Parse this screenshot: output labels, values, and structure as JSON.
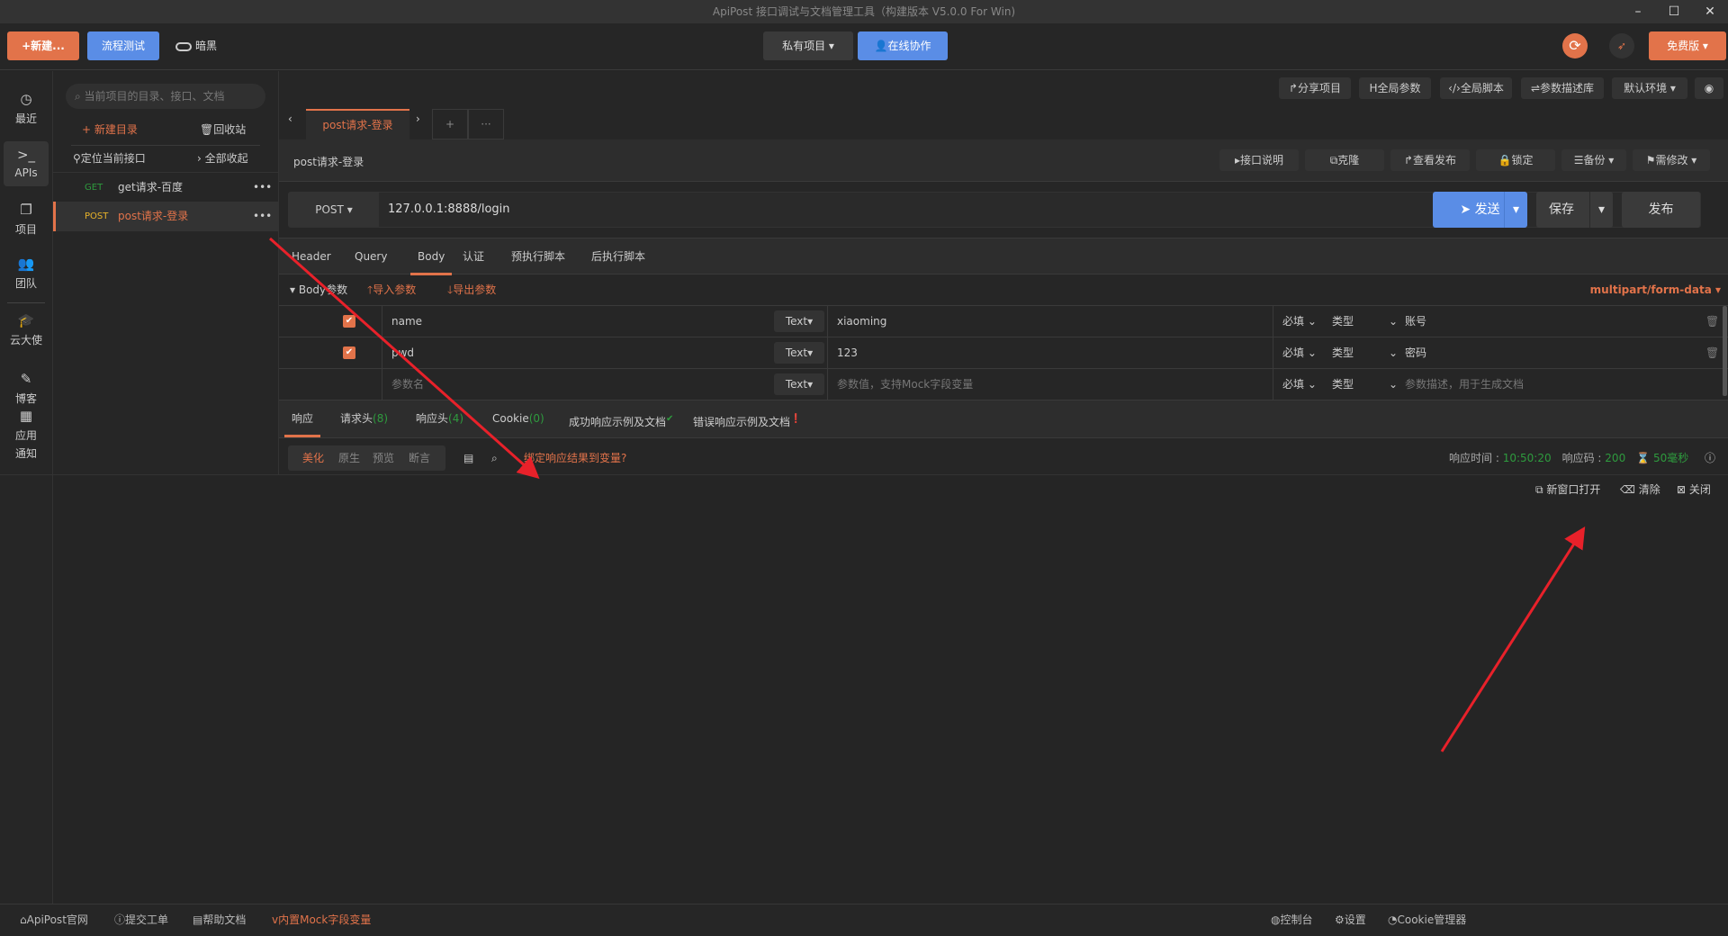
{
  "window": {
    "title": "ApiPost 接口调试与文档管理工具（构建版本 V5.0.0 For Win)",
    "minimize": "–",
    "maximize": "☐",
    "close": "✕"
  },
  "toolbar": {
    "new": "+新建...",
    "flow_test": "流程测试",
    "dark_mode": "暗黑",
    "project_select": "私有项目",
    "collab": "在线协作",
    "plan": "免费版"
  },
  "rail": [
    {
      "label": "最近",
      "icon": "clock-icon"
    },
    {
      "label": "APIs",
      "icon": "terminal-icon"
    },
    {
      "label": "项目",
      "icon": "project-icon"
    },
    {
      "label": "团队",
      "icon": "team-icon"
    },
    {
      "label": "云大使",
      "icon": "graduation-cap-icon"
    },
    {
      "label": "博客",
      "icon": "edit-icon"
    },
    {
      "label": "应用",
      "icon": "grid-icon"
    },
    {
      "label": "通知",
      "icon": ""
    }
  ],
  "sidebar": {
    "search_placeholder": "当前项目的目录、接口、文档",
    "new_folder": "+ 新建目录",
    "recycle": "回收站",
    "locate": "定位当前接口",
    "collapse": "全部收起",
    "items": [
      {
        "method": "GET",
        "name": "get请求-百度",
        "method_color": "#2e9b3e"
      },
      {
        "method": "POST",
        "name": "post请求-登录",
        "method_color": "#e8b32a"
      }
    ]
  },
  "topbar": {
    "share": "分享项目",
    "global_params": "全局参数",
    "global_script": "全局脚本",
    "param_lib": "参数描述库",
    "env": "默认环境"
  },
  "tabs": {
    "active": "post请求-登录",
    "add": "+",
    "more": "···"
  },
  "request": {
    "name": "post请求-登录",
    "actions": [
      "接口说明",
      "克隆",
      "查看发布",
      "锁定",
      "备份",
      "需修改"
    ],
    "method": "POST",
    "url": "127.0.0.1:8888/login",
    "send": "发送",
    "save": "保存",
    "publish": "发布"
  },
  "param_tabs": [
    "Header",
    "Query",
    "Body",
    "认证",
    "预执行脚本",
    "后执行脚本"
  ],
  "body": {
    "label": "Body参数",
    "import": "导入参数",
    "export": "导出参数",
    "content_type": "multipart/form-data",
    "rows": [
      {
        "key": "name",
        "type": "Text",
        "value": "xiaoming",
        "required": "必填",
        "vtype": "类型",
        "desc": "账号",
        "checked": true
      },
      {
        "key": "pwd",
        "type": "Text",
        "value": "123",
        "required": "必填",
        "vtype": "类型",
        "desc": "密码",
        "checked": true
      }
    ],
    "new_row": {
      "key_placeholder": "参数名",
      "type": "Text",
      "value_placeholder": "参数值，支持Mock字段变量",
      "required": "必填",
      "vtype": "类型",
      "desc_placeholder": "参数描述，用于生成文档"
    }
  },
  "response": {
    "tabs": [
      {
        "label": "响应"
      },
      {
        "label": "请求头",
        "count": "(8)"
      },
      {
        "label": "响应头",
        "count": "(4)"
      },
      {
        "label": "Cookie",
        "count": "(0)"
      },
      {
        "label": "成功响应示例及文档"
      },
      {
        "label": "错误响应示例及文档"
      }
    ],
    "views": [
      "美化",
      "原生",
      "预览",
      "断言"
    ],
    "bind": "绑定响应结果到变量?",
    "time_label": "响应时间 :",
    "time": "10:50:20",
    "code_label": "响应码 :",
    "code": "200",
    "duration": "50毫秒",
    "open_new": "新窗口打开",
    "clear": "清除",
    "close": "关闭"
  },
  "footer": {
    "left": [
      "ApiPost官网",
      "提交工单",
      "帮助文档",
      "内置Mock字段变量"
    ],
    "right": [
      "控制台",
      "设置",
      "Cookie管理器"
    ]
  },
  "colors": {
    "accent": "#e2734a",
    "primary": "#5a8de6",
    "annotation": "#e8212a"
  }
}
